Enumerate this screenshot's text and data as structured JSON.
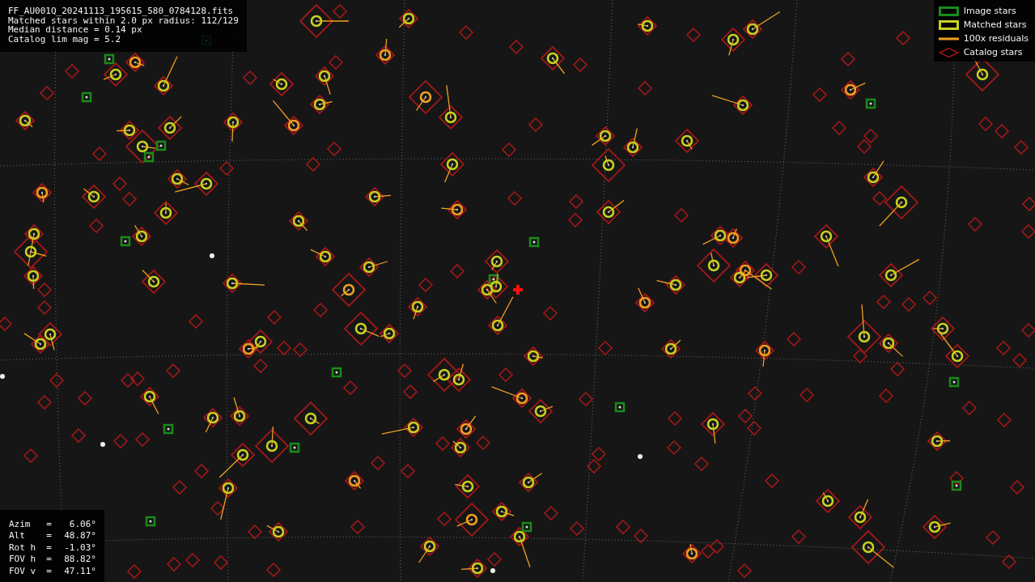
{
  "file_info": {
    "lines": [
      "FF_AU001Q_20241113_195615_580_0784128.fits",
      "Matched stars within 2.0 px radius: 112/129",
      "Median distance = 0.14 px",
      "Catalog lim mag = 5.2"
    ]
  },
  "legend": [
    {
      "kind": "image",
      "label": "Image stars",
      "color": "#1a8a1a"
    },
    {
      "kind": "matched",
      "label": "Matched stars",
      "color": "#c8d21e"
    },
    {
      "kind": "residual",
      "label": "100x residuals",
      "color": "#f0a020"
    },
    {
      "kind": "catalog",
      "label": "Catalog stars",
      "color": "#a01818"
    }
  ],
  "pointing": [
    {
      "label": "Azim   =",
      "value": "6.06°"
    },
    {
      "label": "Alt    =",
      "value": "48.87°"
    },
    {
      "label": "Rot h  =",
      "value": "-1.03°"
    },
    {
      "label": "FOV h  =",
      "value": "88.82°"
    },
    {
      "label": "FOV v  =",
      "value": "47.11°"
    }
  ]
}
